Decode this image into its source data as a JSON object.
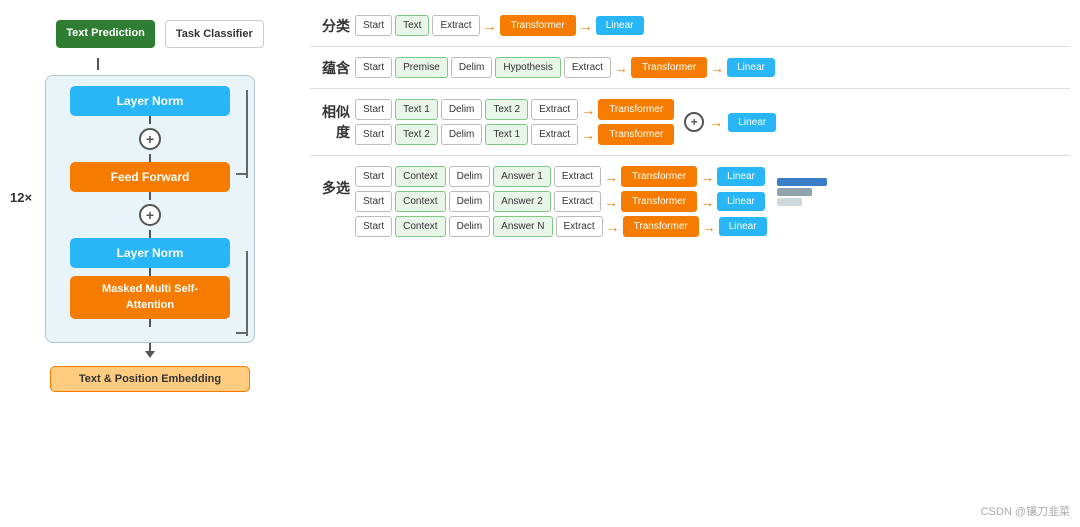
{
  "left": {
    "text_prediction": "Text\nPrediction",
    "task_classifier": "Task\nClassifier",
    "layer_norm_top": "Layer Norm",
    "feed_forward": "Feed Forward",
    "layer_norm_bottom": "Layer Norm",
    "masked_multi": "Masked Multi\nSelf-Attention",
    "embedding": "Text & Position Embedding",
    "label_12x": "12×"
  },
  "tasks": {
    "classification": {
      "label": "分类",
      "items": [
        "Start",
        "Text",
        "Extract",
        "Transformer",
        "Linear"
      ]
    },
    "entailment": {
      "label": "蕴含",
      "items": [
        "Start",
        "Premise",
        "Delim",
        "Hypothesis",
        "Extract",
        "Transformer",
        "Linear"
      ]
    },
    "similarity": {
      "label": "相似度",
      "row1": [
        "Start",
        "Text 1",
        "Delim",
        "Text 2",
        "Extract",
        "Transformer"
      ],
      "row2": [
        "Start",
        "Text 2",
        "Delim",
        "Text 1",
        "Extract",
        "Transformer"
      ],
      "output": "Linear"
    },
    "multiple_choice": {
      "label": "多选",
      "row1": [
        "Start",
        "Context",
        "Delim",
        "Answer 1",
        "Extract",
        "Transformer",
        "Linear"
      ],
      "row2": [
        "Start",
        "Context",
        "Delim",
        "Answer 2",
        "Extract",
        "Transformer",
        "Linear"
      ],
      "row3": [
        "Start",
        "Context",
        "Delim",
        "Answer N",
        "Extract",
        "Transformer",
        "Linear"
      ]
    }
  },
  "watermark": "CSDN @镶刀韭菜",
  "colors": {
    "green": "#2e7d32",
    "blue": "#29b6f6",
    "orange": "#f57c00",
    "light_green_bg": "#e8f5e9",
    "panel_bg": "#e8f4f8"
  }
}
